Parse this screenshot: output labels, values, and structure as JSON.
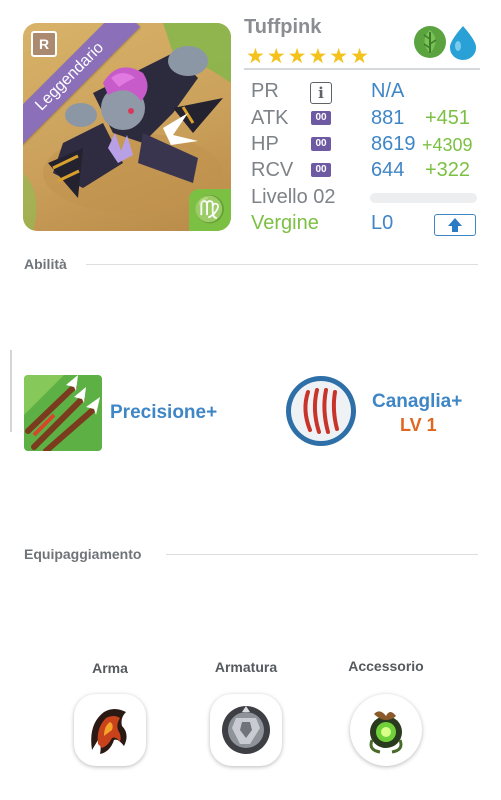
{
  "hero": {
    "name": "Tuffpink",
    "rank_badge": "R",
    "rarity": "Leggendario",
    "star_count": 6,
    "stars": "★★★★★★",
    "zodiac_symbol": "♍",
    "elements": [
      "leaf-icon",
      "water-drop-icon"
    ]
  },
  "stats": {
    "pr": {
      "label": "PR",
      "value": "N/A"
    },
    "atk": {
      "label": "ATK",
      "chip": "00",
      "value": "881",
      "bonus": "+451"
    },
    "hp": {
      "label": "HP",
      "chip": "00",
      "value": "8619",
      "bonus": "+4309"
    },
    "rcv": {
      "label": "RCV",
      "chip": "00",
      "value": "644",
      "bonus": "+322"
    },
    "level": {
      "label": "Livello 02",
      "progress": 0
    },
    "sign": {
      "label": "Vergine",
      "value": "L0"
    }
  },
  "sections": {
    "abilities": "Abilità",
    "equipment": "Equipaggiamento"
  },
  "skills": [
    {
      "name": "Precisione+",
      "icon": "arrows-icon"
    },
    {
      "name": "Canaglia+",
      "level": "LV 1",
      "icon": "claw-icon"
    }
  ],
  "equipment": [
    {
      "label": "Arma",
      "icon": "weapon-icon"
    },
    {
      "label": "Armatura",
      "icon": "armor-icon"
    },
    {
      "label": "Accessorio",
      "icon": "accessory-icon"
    }
  ],
  "colors": {
    "accent_blue": "#3f86c6",
    "bonus_green": "#7cc043",
    "skill_level_orange": "#e0671f",
    "rarity_purple": "#8b6fb8",
    "star_yellow": "#f4c21b"
  }
}
